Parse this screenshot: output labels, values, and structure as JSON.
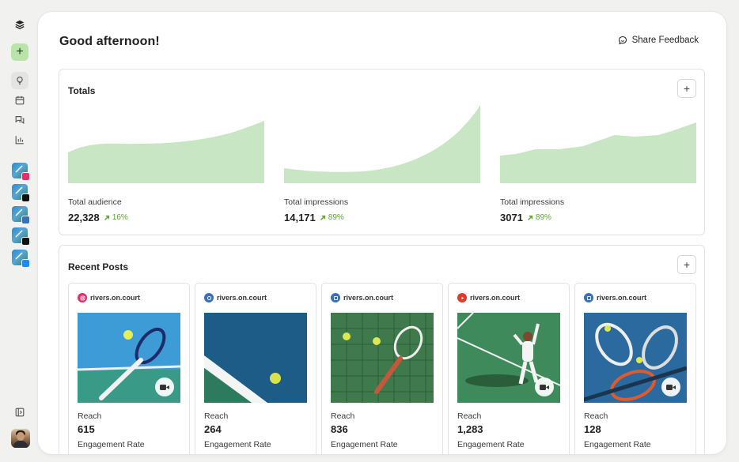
{
  "greeting": "Good afternoon!",
  "feedback_label": "Share Feedback",
  "totals": {
    "title": "Totals",
    "metrics": [
      {
        "label": "Total audience",
        "value": "22,328",
        "change": "16%"
      },
      {
        "label": "Total impressions",
        "value": "14,171",
        "change": "89%"
      },
      {
        "label": "Total impressions",
        "value": "3071",
        "change": "89%"
      }
    ]
  },
  "recent": {
    "title": "Recent Posts",
    "posts": [
      {
        "network": "instagram",
        "handle": "rivers.on.court",
        "reach_label": "Reach",
        "reach": "615",
        "engagement_label": "Engagement Rate",
        "video": true
      },
      {
        "network": "threads",
        "handle": "rivers.on.court",
        "reach_label": "Reach",
        "reach": "264",
        "engagement_label": "Engagement Rate",
        "video": false
      },
      {
        "network": "linkedin",
        "handle": "rivers.on.court",
        "reach_label": "Reach",
        "reach": "836",
        "engagement_label": "Engagement Rate",
        "video": false
      },
      {
        "network": "youtube",
        "handle": "rivers.on.court",
        "reach_label": "Reach",
        "reach": "1,283",
        "engagement_label": "Engagement Rate",
        "video": true
      },
      {
        "network": "linkedin",
        "handle": "rivers.on.court",
        "reach_label": "Reach",
        "reach": "128",
        "engagement_label": "Engagement Rate",
        "video": true
      }
    ]
  },
  "colors": {
    "accent_green": "#b9e3a8",
    "area_fill": "#c8e6c4",
    "change_green": "#5aa832",
    "instagram": "#e1306c",
    "linkedin": "#3b6fb6",
    "youtube": "#e03a2f"
  },
  "sidebar": {
    "icons": [
      "layers-icon",
      "add-icon",
      "lightbulb-icon",
      "calendar-icon",
      "chat-icon",
      "analytics-icon",
      "panel-toggle-icon"
    ],
    "accounts": [
      "instagram",
      "threads",
      "linkedin",
      "x",
      "bluesky"
    ]
  }
}
